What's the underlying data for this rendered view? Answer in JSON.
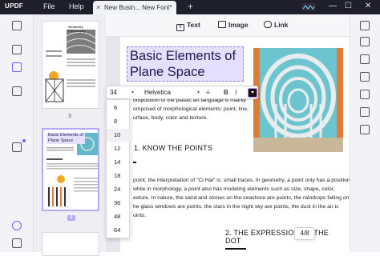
{
  "app": {
    "logo": "UPDF",
    "menu_file": "File",
    "menu_help": "Help"
  },
  "tab": {
    "title": "New Busin... New Font*",
    "close": "×",
    "new_tab": "+"
  },
  "window": {
    "minimize": "—",
    "maximize": "☐",
    "close": "✕"
  },
  "toolbar": {
    "text_label": "Text",
    "image_label": "Image",
    "link_label": "Link"
  },
  "thumbnails": {
    "page3": {
      "title_line1": "Geometry",
      "title_line2": "Philosophy",
      "number": "3"
    },
    "page4": {
      "title_line1": "Basic Elements of",
      "title_line2": "Plane Space",
      "number": "4"
    }
  },
  "document": {
    "heading_line1": "Basic Elements of",
    "heading_line2": "Plane Space",
    "intro_lines": [
      "omposition of the plastic art language is mainly",
      "omposed of morphological elements: point, line,",
      "urface, body, color and texture."
    ],
    "section1": "1. KNOW THE POINTS",
    "point_lines": [
      "point, the interpretation of \"Ci Hai\" is: small traces. In geometry, a point only has a position,",
      "while in morphology, a point also has modeling elements such as size, shape, color,",
      "exture. In nature, the sand and stones on the seashore are points, the raindrops falling on",
      "he glass windows are points, the stars in the night sky are points, the dust in the air is",
      "oints."
    ],
    "section2_line1": "2. THE EXPRESSION OF THE",
    "section2_line2": "DOT"
  },
  "font_toolbar": {
    "size": "34",
    "font": "Helvetica",
    "align_icon": "align-icon",
    "bold": "B",
    "italic": "I",
    "color": "#111111"
  },
  "font_sizes": [
    "6",
    "8",
    "10",
    "12",
    "14",
    "18",
    "24",
    "36",
    "48",
    "64"
  ],
  "font_sizes_selected": "10",
  "page_indicator": "4/8",
  "colors": {
    "accent": "#7b5cf5",
    "titlebar": "#1f1f2b",
    "selection": "#e5e0ff"
  }
}
